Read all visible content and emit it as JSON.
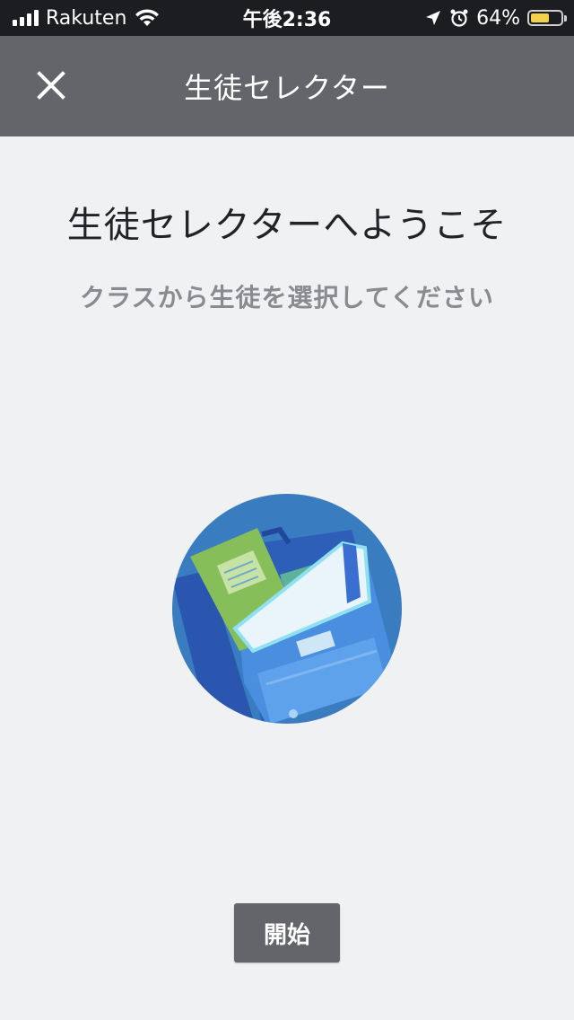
{
  "status_bar": {
    "carrier": "Rakuten",
    "time": "午後2:36",
    "battery_percent": "64%",
    "battery_level": 0.64,
    "icons": [
      "signal-bars-icon",
      "wifi-icon",
      "location-arrow-icon",
      "alarm-clock-icon",
      "battery-icon"
    ]
  },
  "header": {
    "title": "生徒セレクター",
    "close_icon": "close-icon"
  },
  "main": {
    "heading": "生徒セレクターへようこそ",
    "subheading": "クラスから生徒を選択してください",
    "illustration": "backpack-with-notebook"
  },
  "footer": {
    "start_label": "開始"
  },
  "colors": {
    "header_bg": "#63656a",
    "page_bg": "#f0f1f3",
    "button_bg": "#63656a",
    "illustration_circle": "#3a7cc0"
  }
}
